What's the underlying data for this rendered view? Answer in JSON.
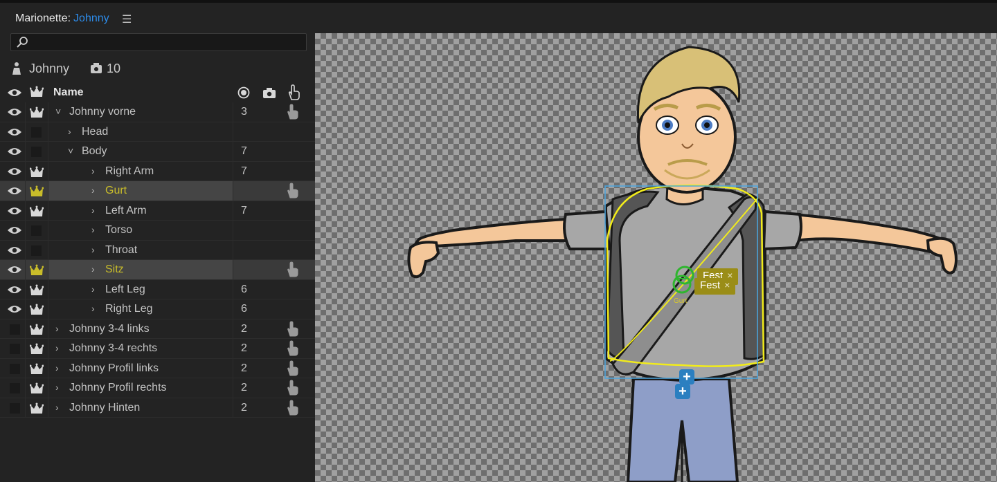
{
  "title": {
    "prefix": "Marionette:",
    "puppet": "Johnny",
    "menu_icon": "hamburger-icon"
  },
  "search": {
    "placeholder": "",
    "value": ""
  },
  "puppet_info": {
    "name": "Johnny",
    "handle_count": "10"
  },
  "table": {
    "header": {
      "name": "Name"
    },
    "rows": [
      {
        "label": "Johnny vorne",
        "chevron": "˅",
        "num": "3",
        "visible": true,
        "crown": "white",
        "hand": true,
        "selected": false
      },
      {
        "label": "Head",
        "chevron": "›",
        "num": "",
        "visible": true,
        "crown": "none",
        "hand": false,
        "selected": false
      },
      {
        "label": "Body",
        "chevron": "˅",
        "num": "7",
        "visible": true,
        "crown": "none",
        "hand": false,
        "selected": false
      },
      {
        "label": "Right Arm",
        "chevron": "›",
        "num": "7",
        "visible": true,
        "crown": "white",
        "hand": false,
        "selected": false
      },
      {
        "label": "Gurt",
        "chevron": "›",
        "num": "",
        "visible": true,
        "crown": "yellow",
        "hand": true,
        "selected": true
      },
      {
        "label": "Left Arm",
        "chevron": "›",
        "num": "7",
        "visible": true,
        "crown": "white",
        "hand": false,
        "selected": false
      },
      {
        "label": "Torso",
        "chevron": "›",
        "num": "",
        "visible": true,
        "crown": "none",
        "hand": false,
        "selected": false
      },
      {
        "label": "Throat",
        "chevron": "›",
        "num": "",
        "visible": true,
        "crown": "none",
        "hand": false,
        "selected": false
      },
      {
        "label": "Sitz",
        "chevron": "›",
        "num": "",
        "visible": true,
        "crown": "yellow",
        "hand": true,
        "selected": true
      },
      {
        "label": "Left Leg",
        "chevron": "›",
        "num": "6",
        "visible": true,
        "crown": "white",
        "hand": false,
        "selected": false
      },
      {
        "label": "Right Leg",
        "chevron": "›",
        "num": "6",
        "visible": true,
        "crown": "white",
        "hand": false,
        "selected": false
      },
      {
        "label": "Johnny 3-4 links",
        "chevron": "›",
        "num": "2",
        "visible": false,
        "crown": "white",
        "hand": true,
        "selected": false
      },
      {
        "label": "Johnny 3-4 rechts",
        "chevron": "›",
        "num": "2",
        "visible": false,
        "crown": "white",
        "hand": true,
        "selected": false
      },
      {
        "label": "Johnny Profil links",
        "chevron": "›",
        "num": "2",
        "visible": false,
        "crown": "white",
        "hand": true,
        "selected": false
      },
      {
        "label": "Johnny Profil rechts",
        "chevron": "›",
        "num": "2",
        "visible": false,
        "crown": "white",
        "hand": true,
        "selected": false
      },
      {
        "label": "Johnny Hinten",
        "chevron": "›",
        "num": "2",
        "visible": false,
        "crown": "white",
        "hand": true,
        "selected": false
      }
    ]
  },
  "canvas": {
    "tags": [
      {
        "label": "Fest",
        "close": "×"
      },
      {
        "label": "Fest",
        "close": "×"
      }
    ],
    "handle_label": "Gurt",
    "add_buttons": [
      "+",
      "+"
    ]
  },
  "colors": {
    "accent_blue": "#2d8ceb",
    "selection_yellow": "#c9bd2a",
    "handle_green": "#2fb52f",
    "tag_bg": "#9a8d17"
  }
}
